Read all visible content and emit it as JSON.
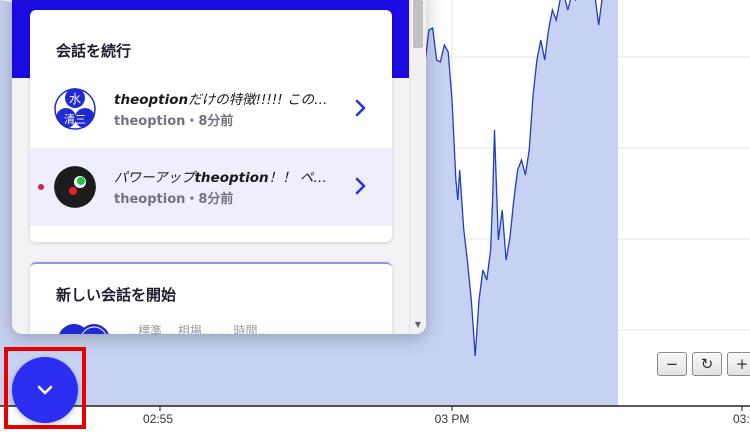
{
  "chart_data": {
    "type": "line",
    "x_ticks": [
      "02:55",
      "03 PM",
      "03:"
    ],
    "series_color": "#1f3fbf",
    "fill_color": "#c7d2f2",
    "points": [
      [
        0,
        260
      ],
      [
        0.15,
        244
      ],
      [
        0.2,
        218
      ],
      [
        0.23,
        176
      ],
      [
        0.3,
        140
      ],
      [
        0.35,
        104
      ],
      [
        0.43,
        86
      ],
      [
        0.55,
        70
      ],
      [
        0.62,
        40
      ],
      [
        0.7,
        10
      ],
      [
        0.74,
        -4
      ],
      [
        0.78,
        12
      ],
      [
        0.81,
        36
      ],
      [
        0.85,
        42
      ],
      [
        0.88,
        34
      ],
      [
        0.92,
        16
      ],
      [
        0.97,
        32
      ],
      [
        1,
        46
      ]
    ]
  },
  "zoom_controls": {
    "zoom_out": "−",
    "reset": "↻",
    "zoom_in": "+"
  },
  "panel": {
    "continue_title": "会話を続行",
    "conversations": [
      {
        "title_bold": "theoption",
        "title_rest": "だけの特徴!!!!! この…",
        "subtitle": "theoption・8分前",
        "avatar": "kanji-avatar",
        "avatar_text_1": "水",
        "avatar_text_2": "清三",
        "unread": false
      },
      {
        "title_prefix": "パワーアップ",
        "title_bold": "theoption",
        "title_rest": "！！ ペ…",
        "subtitle": "theoption・8分前",
        "avatar": "dots-avatar",
        "unread": true
      }
    ],
    "new_title": "新しい会話を開始",
    "new_preview": "…標準… 相場… … 時間…"
  },
  "colors": {
    "brand": "#1a0be0",
    "launcher": "#2b2df0",
    "highlight": "#e60000"
  }
}
